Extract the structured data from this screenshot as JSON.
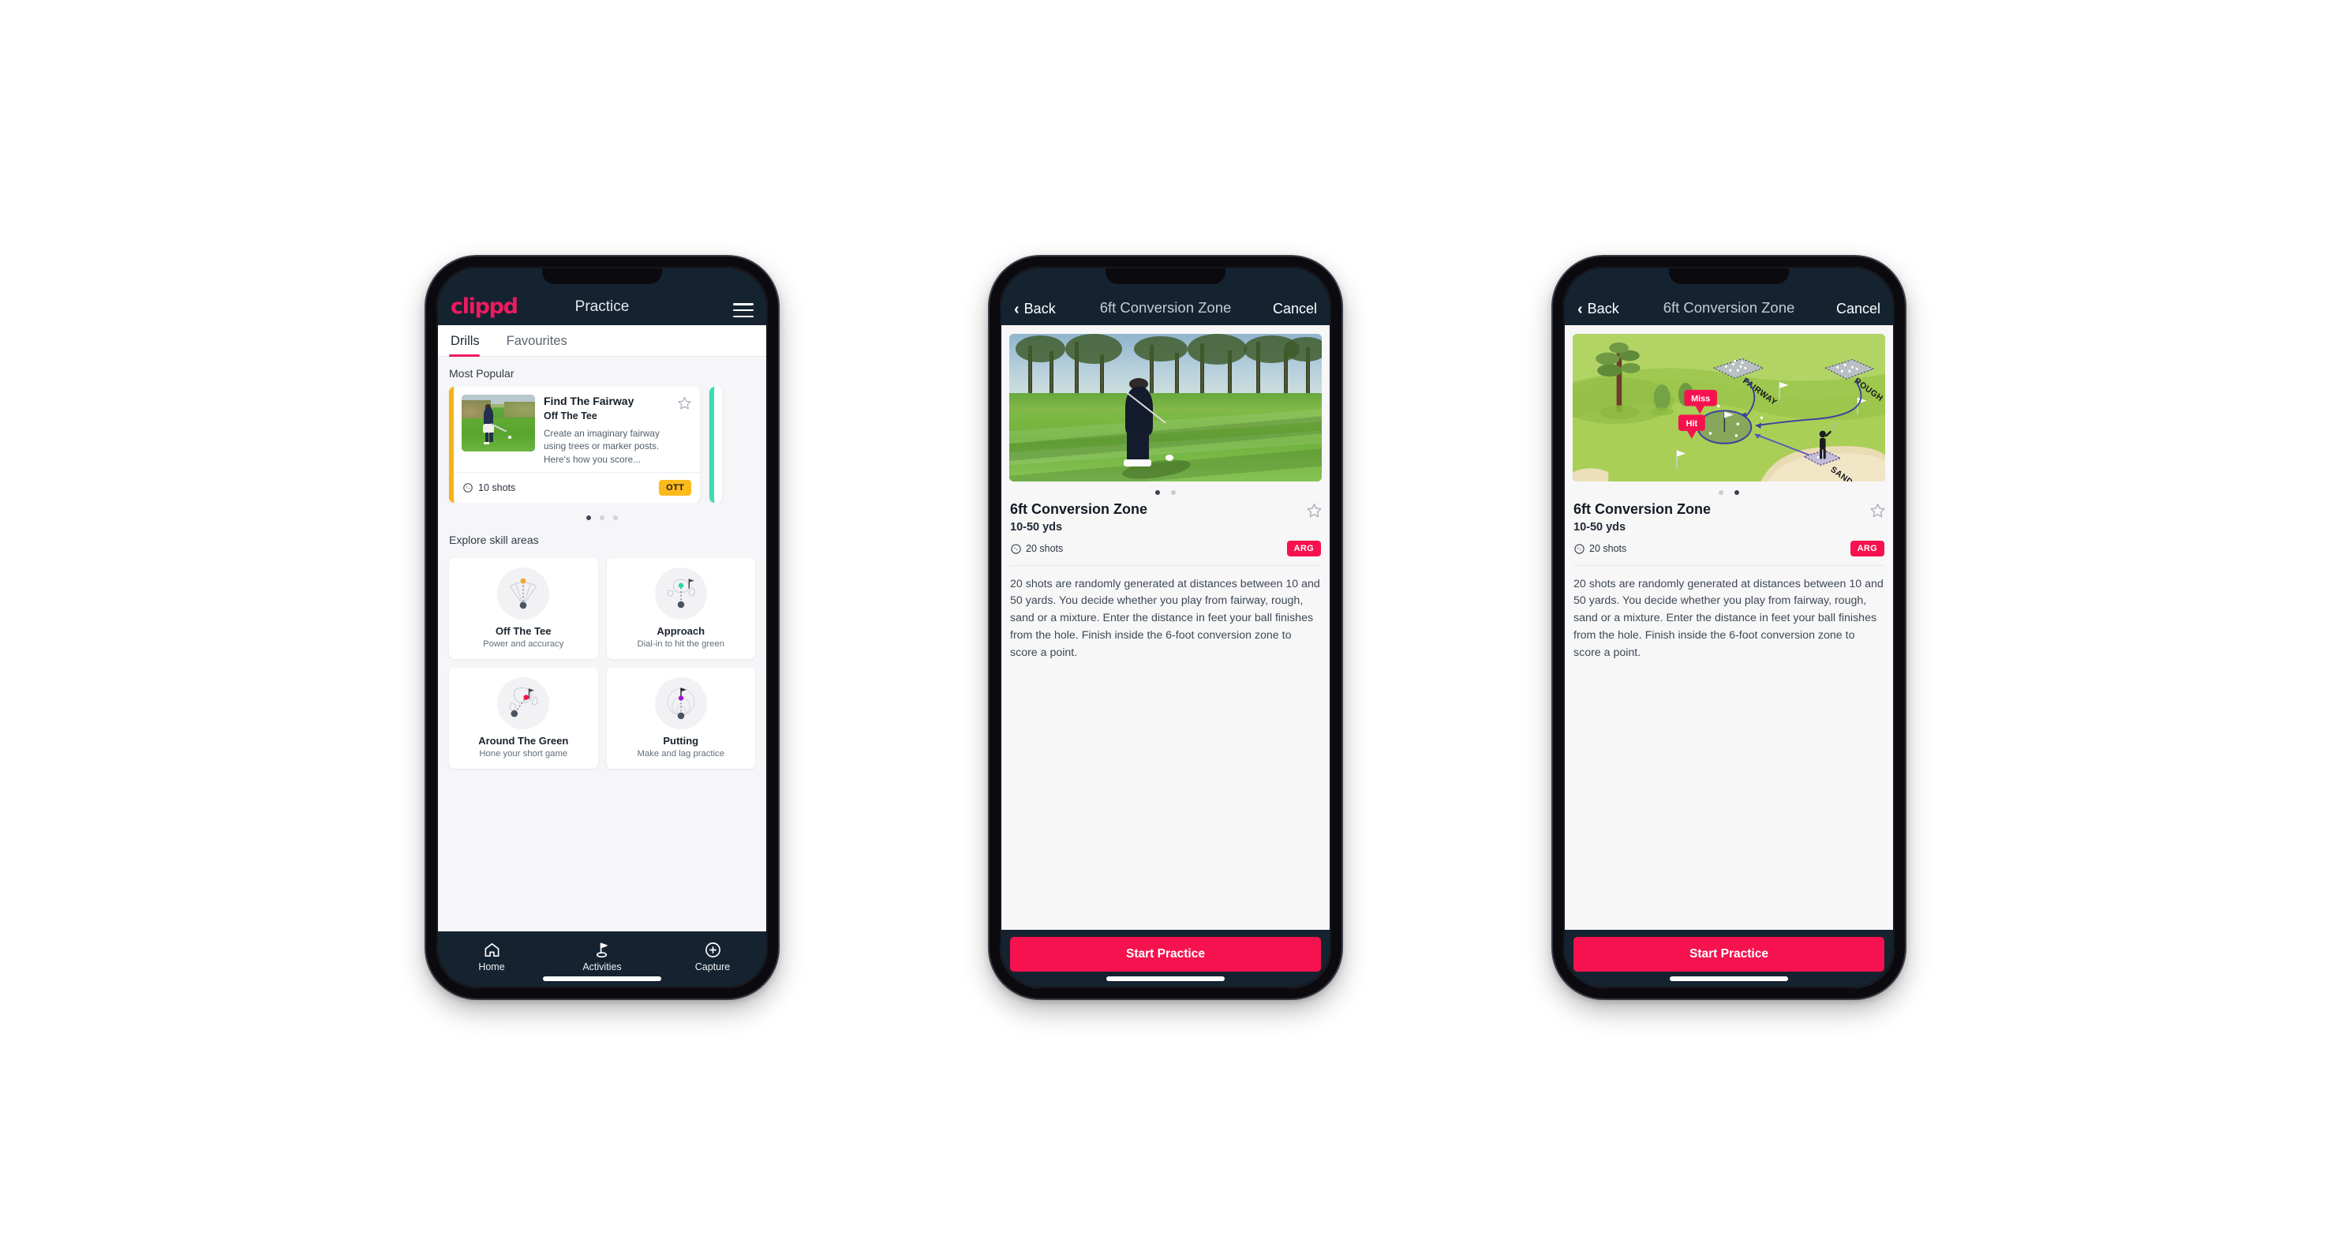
{
  "app": {
    "brand": "clippd",
    "accent_pink": "#ee1a5f",
    "accent_crimson": "#f5124f",
    "header_navy": "#152331",
    "badge_yellow": "#fcbb1b",
    "badge_teal": "#3ddbb0"
  },
  "phone1": {
    "header": {
      "logo": "clippd",
      "title": "Practice",
      "menu_icon": "hamburger-icon"
    },
    "tabs": [
      {
        "label": "Drills",
        "active": true
      },
      {
        "label": "Favourites",
        "active": false
      }
    ],
    "sections": {
      "most_popular_title": "Most Popular",
      "explore_title": "Explore skill areas"
    },
    "featured_drill": {
      "name": "Find The Fairway",
      "category": "Off The Tee",
      "description": "Create an imaginary fairway using trees or marker posts. Here's how you score...",
      "shots": "10 shots",
      "badge": "OTT",
      "badge_color": "#fcbb1b",
      "accent_color": "#f6b319",
      "favourite_icon": "star-outline-icon"
    },
    "carousel_dots": {
      "count": 3,
      "active_index": 0
    },
    "skill_areas": [
      {
        "name": "Off The Tee",
        "desc": "Power and accuracy",
        "icon": "tee-dispersion-icon",
        "dot_color": "#f5a623"
      },
      {
        "name": "Approach",
        "desc": "Dial-in to hit the green",
        "icon": "approach-green-icon",
        "dot_color": "#2ad9a8"
      },
      {
        "name": "Around The Green",
        "desc": "Hone your short game",
        "icon": "chip-green-icon",
        "dot_color": "#f5124f"
      },
      {
        "name": "Putting",
        "desc": "Make and lag practice",
        "icon": "putting-rings-icon",
        "dot_color": "#a915d6"
      }
    ],
    "bottom_nav": [
      {
        "label": "Home",
        "icon": "home-icon",
        "active": false
      },
      {
        "label": "Activities",
        "icon": "golf-flag-icon",
        "active": true
      },
      {
        "label": "Capture",
        "icon": "plus-circle-icon",
        "active": false
      }
    ]
  },
  "phone2": {
    "nav": {
      "back_label": "Back",
      "back_icon": "chevron-left-icon",
      "title": "6ft Conversion Zone",
      "cancel_label": "Cancel"
    },
    "media_kind": "photo",
    "media_alt": "Golfer playing a pitch shot on a tree-lined fairway",
    "dots": {
      "count": 2,
      "active_index": 0
    },
    "drill": {
      "title": "6ft Conversion Zone",
      "distance": "10-50 yds",
      "shots": "20 shots",
      "badge": "ARG",
      "badge_color": "#f5124f",
      "favourite_icon": "star-outline-icon",
      "description": "20 shots are randomly generated at distances between 10 and 50 yards. You decide whether you play from fairway, rough, sand or a mixture. Enter the distance in feet your ball finishes from the hole. Finish inside the 6-foot conversion zone to score a point."
    },
    "cta_label": "Start Practice"
  },
  "phone3": {
    "nav": {
      "back_label": "Back",
      "back_icon": "chevron-left-icon",
      "title": "6ft Conversion Zone",
      "cancel_label": "Cancel"
    },
    "media_kind": "illustration",
    "media_alt": "Illustrated golf hole showing shots played from fairway, rough and sand toward a 6-foot conversion zone around the green",
    "illustration_labels": {
      "fairway": "FAIRWAY",
      "rough": "ROUGH",
      "sand": "SAND",
      "miss": "Miss",
      "hit": "Hit"
    },
    "dots": {
      "count": 2,
      "active_index": 1
    },
    "drill": {
      "title": "6ft Conversion Zone",
      "distance": "10-50 yds",
      "shots": "20 shots",
      "badge": "ARG",
      "badge_color": "#f5124f",
      "favourite_icon": "star-outline-icon",
      "description": "20 shots are randomly generated at distances between 10 and 50 yards. You decide whether you play from fairway, rough, sand or a mixture. Enter the distance in feet your ball finishes from the hole. Finish inside the 6-foot conversion zone to score a point."
    },
    "cta_label": "Start Practice"
  }
}
